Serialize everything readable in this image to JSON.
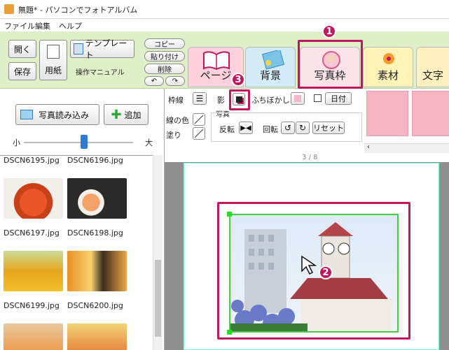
{
  "window": {
    "title": "無題* - パソコンでフォトアルバム"
  },
  "menu": {
    "items": [
      "ファイル",
      "編集",
      "ヘルプ"
    ]
  },
  "toolbar": {
    "open_label": "開く",
    "save_label": "保存",
    "paper_label": "用紙",
    "template_label": "テンプレート",
    "manual_label": "操作マニュアル",
    "copy_label": "コピー",
    "paste_label": "貼り付け",
    "delete_label": "削除"
  },
  "tabs": [
    {
      "label": "ページ"
    },
    {
      "label": "背景"
    },
    {
      "label": "写真枠"
    },
    {
      "label": "素材"
    },
    {
      "label": "文字"
    }
  ],
  "markers": {
    "m1": "1",
    "m2": "2",
    "m3": "3"
  },
  "props": {
    "frame_line": "枠線",
    "shadow": "影",
    "blur": "ふちぼかし",
    "date_label": "日付",
    "photo": "写真",
    "line_color": "線の色",
    "fill": "塗り",
    "flip": "反転",
    "rotate": "回転",
    "reset": "リセット"
  },
  "left": {
    "load_photo": "写真読み込み",
    "add": "追加",
    "size_small": "小",
    "size_large": "大",
    "slider_value": 0.55,
    "files": [
      "DSCN6195.jpg",
      "DSCN6196.jpg",
      "DSCN6197.jpg",
      "DSCN6198.jpg",
      "DSCN6199.jpg",
      "DSCN6200.jpg"
    ]
  },
  "canvas": {
    "page_indicator": "3 / 8"
  },
  "colors": {
    "accent": "#c0185e",
    "toolbar_bg": "#dff0c8"
  }
}
